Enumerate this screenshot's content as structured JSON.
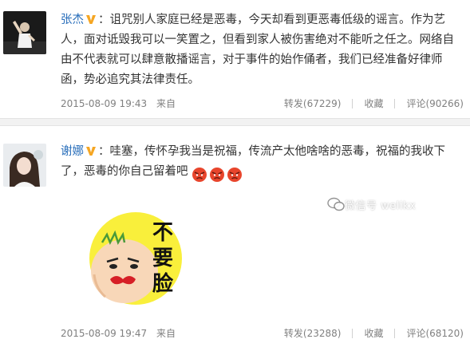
{
  "posts": [
    {
      "username": "张杰",
      "body": "：诅咒别人家庭已经是恶毒，今天却看到更恶毒低级的谣言。作为艺人，面对诋毁我可以一笑置之，但看到家人被伤害绝对不能听之任之。网络自由不代表就可以肆意散播谣言，对于事件的始作俑者，我们已经准备好律师函，势必追究其法律责任。",
      "time": "2015-08-09 19:43",
      "source": "来自",
      "repost": "转发(67229)",
      "favorite": "收藏",
      "comment": "评论(90266)"
    },
    {
      "username": "谢娜",
      "body": "：哇塞，传怀孕我当是祝福，传流产太他啥啥的恶毒，祝福的我收下了，恶毒的你自己留着吧",
      "time": "2015-08-09 19:47",
      "source": "来自",
      "repost": "转发(23288)",
      "favorite": "收藏",
      "comment": "评论(68120)",
      "sticker_text": "不要脸"
    }
  ],
  "watermark": "微信号 welikx",
  "colors": {
    "username": "#2a6fbb",
    "meta": "#808080",
    "separator": "#f2f2f2",
    "vbadge": "#f5a623"
  },
  "icons": [
    "verified-badge-icon",
    "angry-emoji-icon",
    "wechat-icon"
  ]
}
